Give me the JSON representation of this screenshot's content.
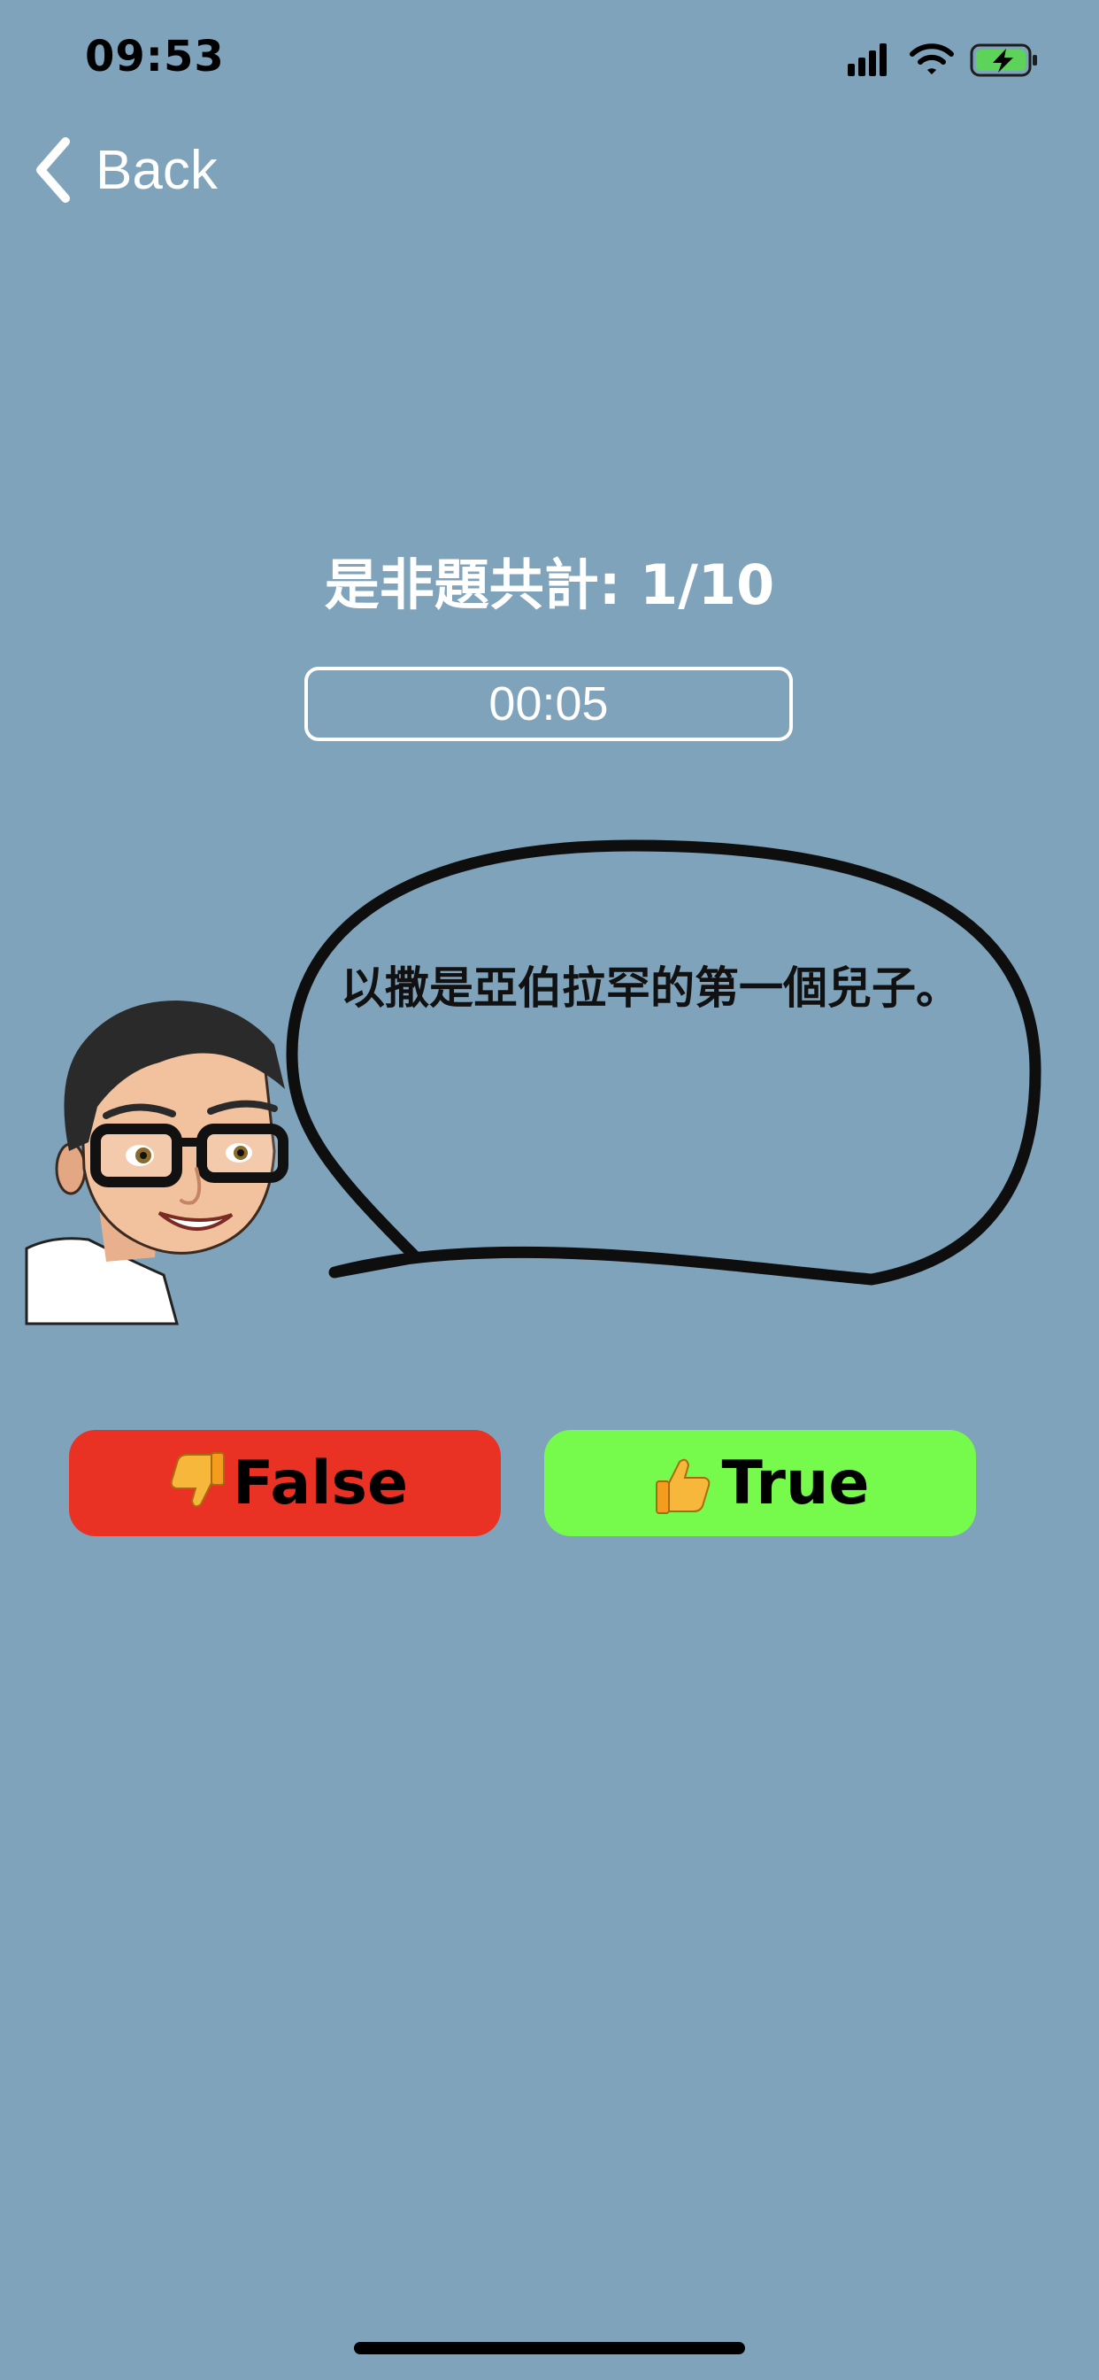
{
  "status_bar": {
    "time": "09:53",
    "icons": [
      "cellular-signal-icon",
      "wifi-icon",
      "battery-charging-icon"
    ]
  },
  "nav": {
    "back_label": "Back"
  },
  "quiz": {
    "count_label": "是非題共計: 1/10",
    "timer": "00:05",
    "question": "以撒是亞伯拉罕的第一個兒子。"
  },
  "answers": {
    "false_label": "False",
    "true_label": "True"
  },
  "colors": {
    "background": "#7FA3BB",
    "false_button": "#E93223",
    "true_button": "#76FB4D",
    "battery": "#5DD35A"
  }
}
